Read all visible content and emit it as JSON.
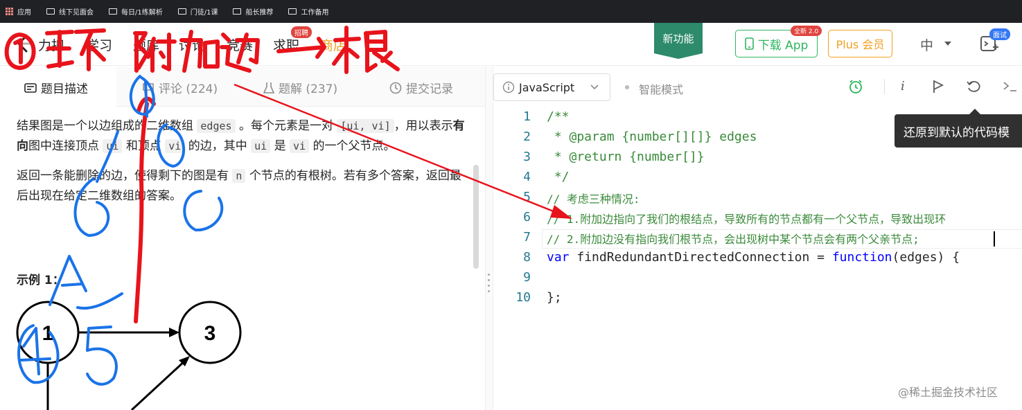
{
  "bookmarks": [
    "应用",
    "线下见面会",
    "每日/1练解析",
    "门徒/1课",
    "船长推荐",
    "工作备用"
  ],
  "nav": {
    "brand": "力扣",
    "items": [
      "学习",
      "题库",
      "讨论",
      "竞赛",
      "求职",
      "商店"
    ],
    "hire_badge": "招聘",
    "new_feature": "新功能",
    "download_app": "下载 App",
    "app_badge": "全新 2.0",
    "plus": "Plus 会员",
    "lang": "中",
    "interview_badge": "面试"
  },
  "tabs": [
    {
      "label": "题目描述",
      "icon": "description-icon"
    },
    {
      "label": "评论 (224)",
      "icon": "comment-icon"
    },
    {
      "label": "题解 (237)",
      "icon": "flask-icon"
    },
    {
      "label": "提交记录",
      "icon": "clock-icon"
    }
  ],
  "description": {
    "p1_a": "结果图是一个以边组成的二维数组",
    "p1_code1": "edges",
    "p1_b": "。每个元素是一对",
    "p1_code2": "[ui, vi]",
    "p1_c": "，用以表示",
    "p1_d": "有向",
    "p1_e": "图中连接顶点",
    "p1_code3": "ui",
    "p1_f": "和顶点",
    "p1_code4": "vi",
    "p1_g": "的边，其中",
    "p1_code5": "ui",
    "p1_h": "是",
    "p1_code6": "vi",
    "p1_i": "的一个父节点。",
    "p2_a": "返回一条能删除的边，使得剩下的图是有",
    "p2_code": "n",
    "p2_b": "个节点的有根树。若有多个答案，返回最后出现在给定二维数组的答案。",
    "example_title": "示例 1："
  },
  "graph": {
    "nodes": [
      "1",
      "3"
    ]
  },
  "toolbar": {
    "language": "JavaScript",
    "smart_mode": "智能模式",
    "tooltip": "还原到默认的代码模"
  },
  "code_lines": [
    {
      "n": "1",
      "text": "/**"
    },
    {
      "n": "2",
      "text": " * @param {number[][]} edges"
    },
    {
      "n": "3",
      "text": " * @return {number[]}"
    },
    {
      "n": "4",
      "text": " */"
    },
    {
      "n": "5",
      "text": "// 考虑三种情况:"
    },
    {
      "n": "6",
      "text": "// 1.附加边指向了我们的根结点，导致所有的节点都有一个父节点，导致出现环"
    },
    {
      "n": "7",
      "text": "// 2.附加边没有指向我们根节点，会出现树中某个节点会有两个父亲节点;"
    },
    {
      "n": "8",
      "kw": "var",
      "mid": " findRedundantDirectedConnection = ",
      "kw2": "function",
      "tail": "(edges) {"
    },
    {
      "n": "9",
      "text": ""
    },
    {
      "n": "10",
      "text": "};"
    }
  ],
  "annotation": "①环 附加边→根",
  "watermark": "@稀土掘金技术社区",
  "colors": {
    "accent_green": "#2db55d",
    "plus_orange": "#f0a020",
    "newfeature": "#2d8a6b",
    "ink_red": "#e8131b",
    "ink_blue": "#1a73e8"
  }
}
